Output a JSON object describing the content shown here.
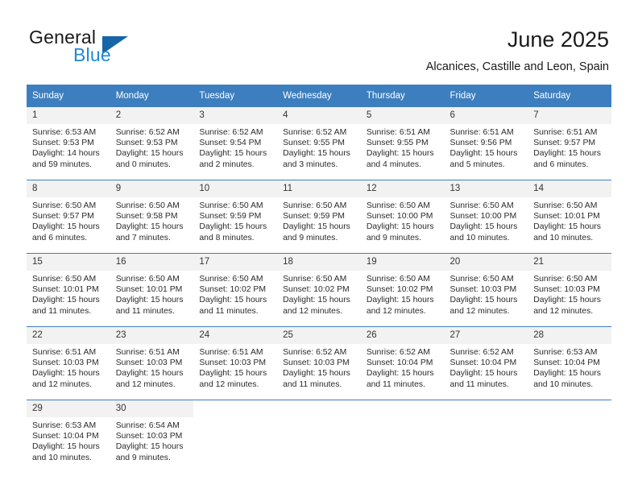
{
  "brand": {
    "word_top": "General",
    "word_bottom": "Blue",
    "triangle_color": "#1565a8",
    "blue_text_color": "#1e88d8"
  },
  "header": {
    "title": "June 2025",
    "location": "Alcanices, Castille and Leon, Spain"
  },
  "theme": {
    "header_blue": "#3d7ebf",
    "daynum_band": "#f2f2f2",
    "row_divider": "#3d7ebf"
  },
  "weekday_headers": [
    "Sunday",
    "Monday",
    "Tuesday",
    "Wednesday",
    "Thursday",
    "Friday",
    "Saturday"
  ],
  "weeks": [
    [
      {
        "day": "1",
        "sunrise": "Sunrise: 6:53 AM",
        "sunset": "Sunset: 9:53 PM",
        "daylight_1": "Daylight: 14 hours",
        "daylight_2": "and 59 minutes."
      },
      {
        "day": "2",
        "sunrise": "Sunrise: 6:52 AM",
        "sunset": "Sunset: 9:53 PM",
        "daylight_1": "Daylight: 15 hours",
        "daylight_2": "and 0 minutes."
      },
      {
        "day": "3",
        "sunrise": "Sunrise: 6:52 AM",
        "sunset": "Sunset: 9:54 PM",
        "daylight_1": "Daylight: 15 hours",
        "daylight_2": "and 2 minutes."
      },
      {
        "day": "4",
        "sunrise": "Sunrise: 6:52 AM",
        "sunset": "Sunset: 9:55 PM",
        "daylight_1": "Daylight: 15 hours",
        "daylight_2": "and 3 minutes."
      },
      {
        "day": "5",
        "sunrise": "Sunrise: 6:51 AM",
        "sunset": "Sunset: 9:55 PM",
        "daylight_1": "Daylight: 15 hours",
        "daylight_2": "and 4 minutes."
      },
      {
        "day": "6",
        "sunrise": "Sunrise: 6:51 AM",
        "sunset": "Sunset: 9:56 PM",
        "daylight_1": "Daylight: 15 hours",
        "daylight_2": "and 5 minutes."
      },
      {
        "day": "7",
        "sunrise": "Sunrise: 6:51 AM",
        "sunset": "Sunset: 9:57 PM",
        "daylight_1": "Daylight: 15 hours",
        "daylight_2": "and 6 minutes."
      }
    ],
    [
      {
        "day": "8",
        "sunrise": "Sunrise: 6:50 AM",
        "sunset": "Sunset: 9:57 PM",
        "daylight_1": "Daylight: 15 hours",
        "daylight_2": "and 6 minutes."
      },
      {
        "day": "9",
        "sunrise": "Sunrise: 6:50 AM",
        "sunset": "Sunset: 9:58 PM",
        "daylight_1": "Daylight: 15 hours",
        "daylight_2": "and 7 minutes."
      },
      {
        "day": "10",
        "sunrise": "Sunrise: 6:50 AM",
        "sunset": "Sunset: 9:59 PM",
        "daylight_1": "Daylight: 15 hours",
        "daylight_2": "and 8 minutes."
      },
      {
        "day": "11",
        "sunrise": "Sunrise: 6:50 AM",
        "sunset": "Sunset: 9:59 PM",
        "daylight_1": "Daylight: 15 hours",
        "daylight_2": "and 9 minutes."
      },
      {
        "day": "12",
        "sunrise": "Sunrise: 6:50 AM",
        "sunset": "Sunset: 10:00 PM",
        "daylight_1": "Daylight: 15 hours",
        "daylight_2": "and 9 minutes."
      },
      {
        "day": "13",
        "sunrise": "Sunrise: 6:50 AM",
        "sunset": "Sunset: 10:00 PM",
        "daylight_1": "Daylight: 15 hours",
        "daylight_2": "and 10 minutes."
      },
      {
        "day": "14",
        "sunrise": "Sunrise: 6:50 AM",
        "sunset": "Sunset: 10:01 PM",
        "daylight_1": "Daylight: 15 hours",
        "daylight_2": "and 10 minutes."
      }
    ],
    [
      {
        "day": "15",
        "sunrise": "Sunrise: 6:50 AM",
        "sunset": "Sunset: 10:01 PM",
        "daylight_1": "Daylight: 15 hours",
        "daylight_2": "and 11 minutes."
      },
      {
        "day": "16",
        "sunrise": "Sunrise: 6:50 AM",
        "sunset": "Sunset: 10:01 PM",
        "daylight_1": "Daylight: 15 hours",
        "daylight_2": "and 11 minutes."
      },
      {
        "day": "17",
        "sunrise": "Sunrise: 6:50 AM",
        "sunset": "Sunset: 10:02 PM",
        "daylight_1": "Daylight: 15 hours",
        "daylight_2": "and 11 minutes."
      },
      {
        "day": "18",
        "sunrise": "Sunrise: 6:50 AM",
        "sunset": "Sunset: 10:02 PM",
        "daylight_1": "Daylight: 15 hours",
        "daylight_2": "and 12 minutes."
      },
      {
        "day": "19",
        "sunrise": "Sunrise: 6:50 AM",
        "sunset": "Sunset: 10:02 PM",
        "daylight_1": "Daylight: 15 hours",
        "daylight_2": "and 12 minutes."
      },
      {
        "day": "20",
        "sunrise": "Sunrise: 6:50 AM",
        "sunset": "Sunset: 10:03 PM",
        "daylight_1": "Daylight: 15 hours",
        "daylight_2": "and 12 minutes."
      },
      {
        "day": "21",
        "sunrise": "Sunrise: 6:50 AM",
        "sunset": "Sunset: 10:03 PM",
        "daylight_1": "Daylight: 15 hours",
        "daylight_2": "and 12 minutes."
      }
    ],
    [
      {
        "day": "22",
        "sunrise": "Sunrise: 6:51 AM",
        "sunset": "Sunset: 10:03 PM",
        "daylight_1": "Daylight: 15 hours",
        "daylight_2": "and 12 minutes."
      },
      {
        "day": "23",
        "sunrise": "Sunrise: 6:51 AM",
        "sunset": "Sunset: 10:03 PM",
        "daylight_1": "Daylight: 15 hours",
        "daylight_2": "and 12 minutes."
      },
      {
        "day": "24",
        "sunrise": "Sunrise: 6:51 AM",
        "sunset": "Sunset: 10:03 PM",
        "daylight_1": "Daylight: 15 hours",
        "daylight_2": "and 12 minutes."
      },
      {
        "day": "25",
        "sunrise": "Sunrise: 6:52 AM",
        "sunset": "Sunset: 10:03 PM",
        "daylight_1": "Daylight: 15 hours",
        "daylight_2": "and 11 minutes."
      },
      {
        "day": "26",
        "sunrise": "Sunrise: 6:52 AM",
        "sunset": "Sunset: 10:04 PM",
        "daylight_1": "Daylight: 15 hours",
        "daylight_2": "and 11 minutes."
      },
      {
        "day": "27",
        "sunrise": "Sunrise: 6:52 AM",
        "sunset": "Sunset: 10:04 PM",
        "daylight_1": "Daylight: 15 hours",
        "daylight_2": "and 11 minutes."
      },
      {
        "day": "28",
        "sunrise": "Sunrise: 6:53 AM",
        "sunset": "Sunset: 10:04 PM",
        "daylight_1": "Daylight: 15 hours",
        "daylight_2": "and 10 minutes."
      }
    ],
    [
      {
        "day": "29",
        "sunrise": "Sunrise: 6:53 AM",
        "sunset": "Sunset: 10:04 PM",
        "daylight_1": "Daylight: 15 hours",
        "daylight_2": "and 10 minutes."
      },
      {
        "day": "30",
        "sunrise": "Sunrise: 6:54 AM",
        "sunset": "Sunset: 10:03 PM",
        "daylight_1": "Daylight: 15 hours",
        "daylight_2": "and 9 minutes."
      },
      null,
      null,
      null,
      null,
      null
    ]
  ]
}
